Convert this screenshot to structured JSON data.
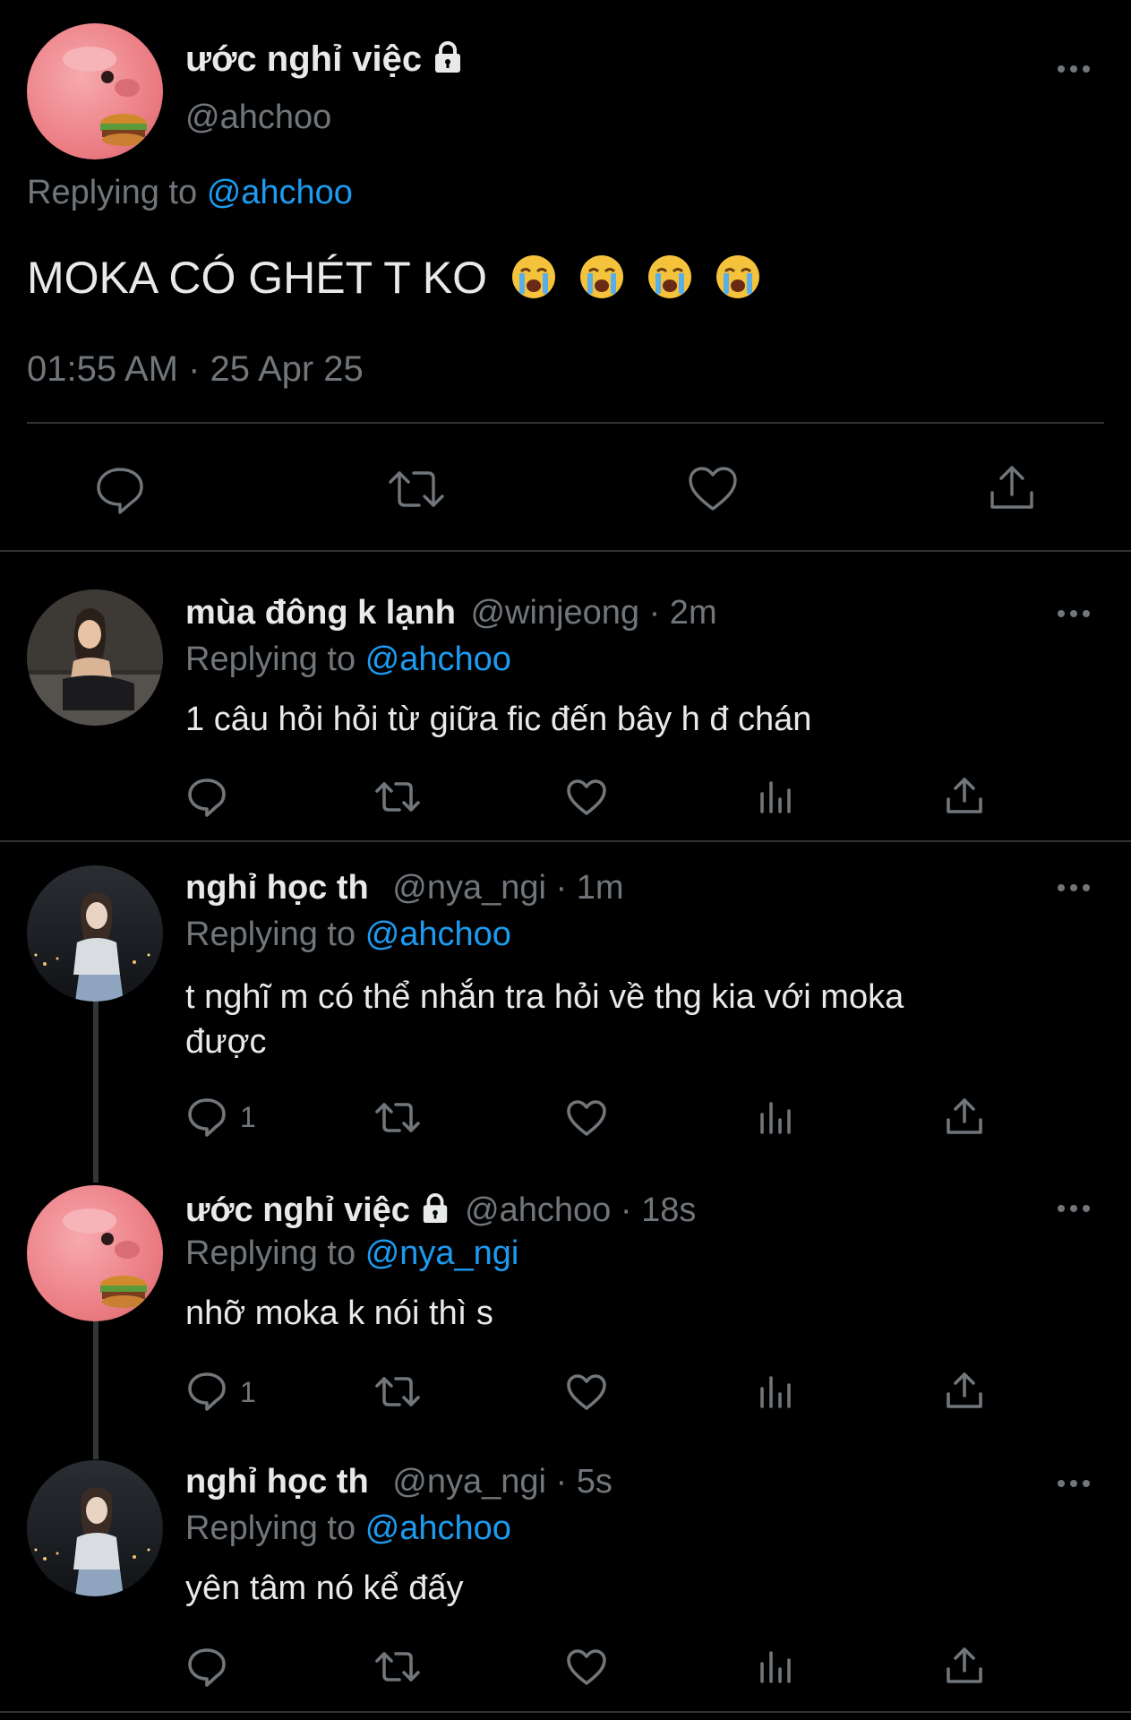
{
  "main_tweet": {
    "display_name": "ước nghỉ việc",
    "handle": "@ahchoo",
    "replying_prefix": "Replying to",
    "replying_to": "@ahchoo",
    "text": "MOKA CÓ GHÉT T KO",
    "timestamp": "01:55 AM · 25 Apr 25"
  },
  "replies": [
    {
      "display_name": "mùa đông k lạnh",
      "meta": "@winjeong · 2m",
      "replying_prefix": "Replying to",
      "replying_to": "@ahchoo",
      "text_line1": "1 câu hỏi hỏi từ giữa fic đến bây h đ chán",
      "text_line2": "",
      "reply_count": ""
    },
    {
      "display_name": "nghỉ học th",
      "meta": "@nya_ngi · 1m",
      "replying_prefix": "Replying to",
      "replying_to": "@ahchoo",
      "text_line1": "t nghĩ m có thể nhắn tra hỏi về thg kia với moka",
      "text_line2": "được",
      "reply_count": "1"
    },
    {
      "display_name": "ước nghỉ việc",
      "meta": "@ahchoo · 18s",
      "replying_prefix": "Replying to",
      "replying_to": "@nya_ngi",
      "text_line1": "nhỡ moka k nói thì s",
      "text_line2": "",
      "reply_count": "1"
    },
    {
      "display_name": "nghỉ học th",
      "meta": "@nya_ngi · 5s",
      "replying_prefix": "Replying to",
      "replying_to": "@ahchoo",
      "text_line1": "yên tâm nó kể đấy",
      "text_line2": "",
      "reply_count": ""
    }
  ],
  "colors": {
    "background": "#000000",
    "text": "#e7e9ea",
    "muted": "#71767b",
    "link": "#1d9bf0",
    "divider": "#2f3336"
  },
  "icons": [
    "lock-icon",
    "more-icon",
    "reply-icon",
    "retweet-icon",
    "like-icon",
    "views-icon",
    "share-icon",
    "loudly-crying-face-emoji"
  ]
}
